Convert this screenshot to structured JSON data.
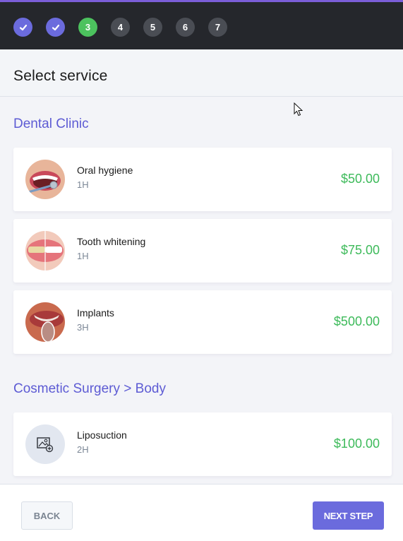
{
  "steps": [
    {
      "label": "✓",
      "state": "done"
    },
    {
      "label": "✓",
      "state": "done"
    },
    {
      "label": "3",
      "state": "current"
    },
    {
      "label": "4",
      "state": "pending"
    },
    {
      "label": "5",
      "state": "pending"
    },
    {
      "label": "6",
      "state": "pending"
    },
    {
      "label": "7",
      "state": "pending"
    }
  ],
  "header": {
    "title": "Select service"
  },
  "categories": [
    {
      "title": "Dental Clinic",
      "services": [
        {
          "name": "Oral hygiene",
          "duration": "1H",
          "price": "$50.00",
          "image": "oral-hygiene-photo"
        },
        {
          "name": "Tooth whitening",
          "duration": "1H",
          "price": "$75.00",
          "image": "tooth-whitening-photo"
        },
        {
          "name": "Implants",
          "duration": "3H",
          "price": "$500.00",
          "image": "implants-photo"
        }
      ]
    },
    {
      "title": "Cosmetic Surgery > Body",
      "services": [
        {
          "name": "Liposuction",
          "duration": "2H",
          "price": "$100.00",
          "image": "image-placeholder-icon"
        }
      ]
    }
  ],
  "footer": {
    "back_label": "BACK",
    "next_label": "NEXT STEP"
  },
  "colors": {
    "accent": "#6b6bdd",
    "step_current": "#4cc25e",
    "step_pending": "#4a4d54",
    "category_title": "#5d5bd4",
    "price": "#3dba5a",
    "topbar": "#25272c",
    "topbar_border": "#7b5ed8"
  }
}
